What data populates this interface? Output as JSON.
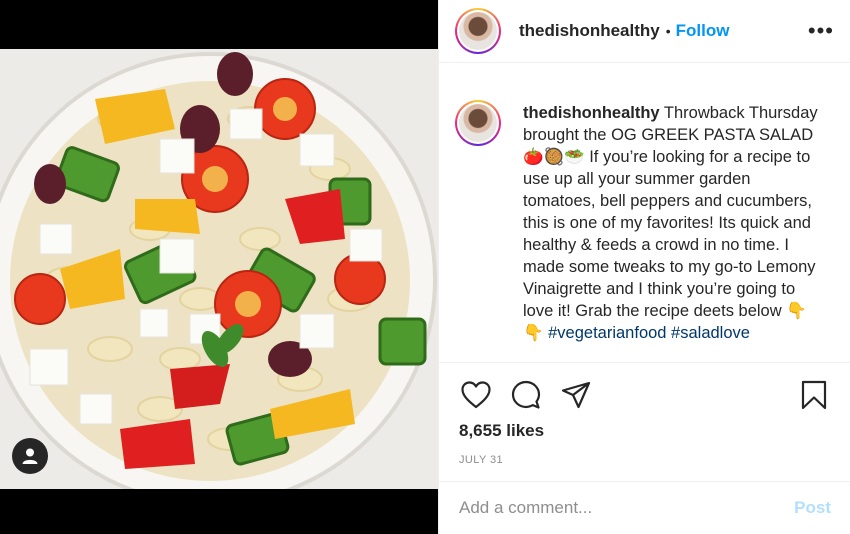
{
  "post": {
    "username": "thedishonhealthy",
    "follow_label": "Follow",
    "header_separator": "•",
    "more_label": "•••",
    "caption_text": "Throwback Thursday brought the OG GREEK PASTA SALAD 🍅🥘🥗 If you’re looking for a recipe to use up all your summer garden tomatoes, bell peppers and cucumbers, this is one of my favorites! Its quick and healthy & feeds a crowd in no time. I made some tweaks to my go-to Lemony Vinaigrette and I think you’re going to love it! Grab the recipe deets below 👇",
    "caption_tags": "👇 #vegetarianfood #saladlove",
    "likes": "8,655 likes",
    "date": "JULY 31"
  },
  "comment": {
    "placeholder": "Add a comment...",
    "post_label": "Post"
  },
  "icons": {
    "like": "heart-icon",
    "comment": "comment-icon",
    "share": "share-icon",
    "save": "bookmark-icon",
    "tagged_user": "user-icon"
  },
  "colors": {
    "follow": "#0095f6",
    "post_disabled": "#b2dffc",
    "muted": "#8e8e8e",
    "text": "#262626"
  }
}
